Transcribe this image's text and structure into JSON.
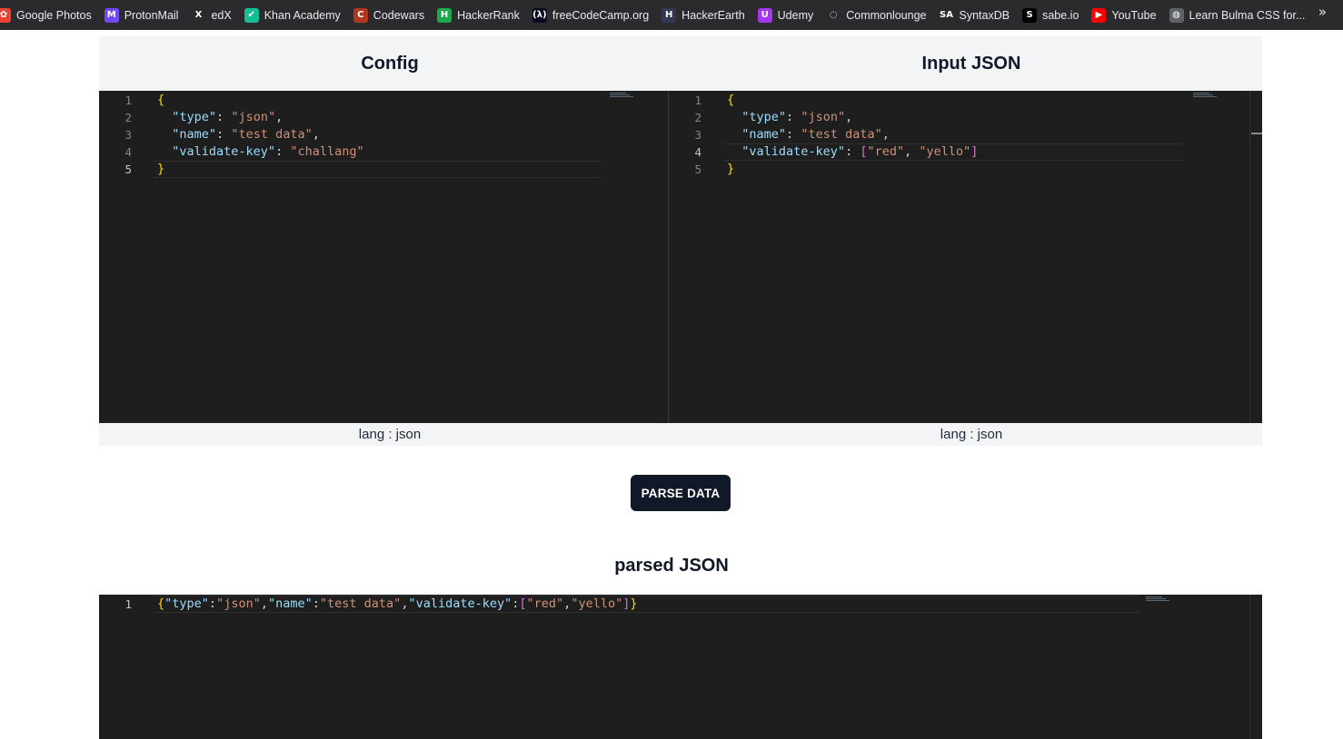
{
  "bookmarks": [
    {
      "label": "Google Photos",
      "icon": "google-photos-icon",
      "color": "#ea4335",
      "glyph": "✿"
    },
    {
      "label": "ProtonMail",
      "icon": "protonmail-icon",
      "color": "#6d4aff",
      "glyph": "M"
    },
    {
      "label": "edX",
      "icon": "edx-icon",
      "color": "#2b2b2e",
      "glyph": "X"
    },
    {
      "label": "Khan Academy",
      "icon": "khan-academy-icon",
      "color": "#14bf96",
      "glyph": "✔"
    },
    {
      "label": "Codewars",
      "icon": "codewars-icon",
      "color": "#b1361e",
      "glyph": "C"
    },
    {
      "label": "HackerRank",
      "icon": "hackerrank-icon",
      "color": "#1ba94c",
      "glyph": "H"
    },
    {
      "label": "freeCodeCamp.org",
      "icon": "freecodecamp-icon",
      "color": "#0a0a23",
      "glyph": "(λ)"
    },
    {
      "label": "HackerEarth",
      "icon": "hackerearth-icon",
      "color": "#323754",
      "glyph": "H"
    },
    {
      "label": "Udemy",
      "icon": "udemy-icon",
      "color": "#a435f0",
      "glyph": "U"
    },
    {
      "label": "Commonlounge",
      "icon": "commonlounge-icon",
      "color": "#2b2b2e",
      "glyph": "◌"
    },
    {
      "label": "SyntaxDB",
      "icon": "syntaxdb-icon",
      "color": "#2b2b2e",
      "glyph": "SA"
    },
    {
      "label": "sabe.io",
      "icon": "sabe-icon",
      "color": "#000000",
      "glyph": "S"
    },
    {
      "label": "YouTube",
      "icon": "youtube-icon",
      "color": "#ff0000",
      "glyph": "▶"
    },
    {
      "label": "Learn Bulma CSS for...",
      "icon": "globe-icon",
      "color": "#5f6368",
      "glyph": "◍"
    }
  ],
  "bookmarks_more": "»",
  "config": {
    "title": "Config",
    "lang": "lang : json",
    "lines": [
      [
        [
          "b1",
          "{"
        ]
      ],
      [
        [
          "p",
          "  "
        ],
        [
          "k",
          "\"type\""
        ],
        [
          "p",
          ": "
        ],
        [
          "s",
          "\"json\""
        ],
        [
          "p",
          ","
        ]
      ],
      [
        [
          "p",
          "  "
        ],
        [
          "k",
          "\"name\""
        ],
        [
          "p",
          ": "
        ],
        [
          "s",
          "\"test data\""
        ],
        [
          "p",
          ","
        ]
      ],
      [
        [
          "p",
          "  "
        ],
        [
          "k",
          "\"validate-key\""
        ],
        [
          "p",
          ": "
        ],
        [
          "s",
          "\"challang\""
        ]
      ],
      [
        [
          "b1",
          "}"
        ]
      ]
    ],
    "active_line": 5
  },
  "input": {
    "title": "Input JSON",
    "lang": "lang : json",
    "lines": [
      [
        [
          "b1",
          "{"
        ]
      ],
      [
        [
          "p",
          "  "
        ],
        [
          "k",
          "\"type\""
        ],
        [
          "p",
          ": "
        ],
        [
          "s",
          "\"json\""
        ],
        [
          "p",
          ","
        ]
      ],
      [
        [
          "p",
          "  "
        ],
        [
          "k",
          "\"name\""
        ],
        [
          "p",
          ": "
        ],
        [
          "s",
          "\"test data\""
        ],
        [
          "p",
          ","
        ]
      ],
      [
        [
          "p",
          "  "
        ],
        [
          "k",
          "\"validate-key\""
        ],
        [
          "p",
          ": "
        ],
        [
          "b2",
          "["
        ],
        [
          "s",
          "\"red\""
        ],
        [
          "p",
          ", "
        ],
        [
          "s",
          "\"yello\""
        ],
        [
          "b2",
          "]"
        ]
      ],
      [
        [
          "b1",
          "}"
        ]
      ]
    ],
    "active_line": 4
  },
  "parse_button": "PARSE DATA",
  "parsed": {
    "title": "parsed JSON",
    "lines": [
      [
        [
          "b1",
          "{"
        ],
        [
          "k",
          "\"type\""
        ],
        [
          "p",
          ":"
        ],
        [
          "s",
          "\"json\""
        ],
        [
          "p",
          ","
        ],
        [
          "k",
          "\"name\""
        ],
        [
          "p",
          ":"
        ],
        [
          "s",
          "\"test data\""
        ],
        [
          "p",
          ","
        ],
        [
          "k",
          "\"validate-key\""
        ],
        [
          "p",
          ":"
        ],
        [
          "b2",
          "["
        ],
        [
          "s",
          "\"red\""
        ],
        [
          "p",
          ","
        ],
        [
          "s",
          "\"yello\""
        ],
        [
          "b2",
          "]"
        ],
        [
          "b1",
          "}"
        ]
      ]
    ],
    "active_line": 1
  }
}
